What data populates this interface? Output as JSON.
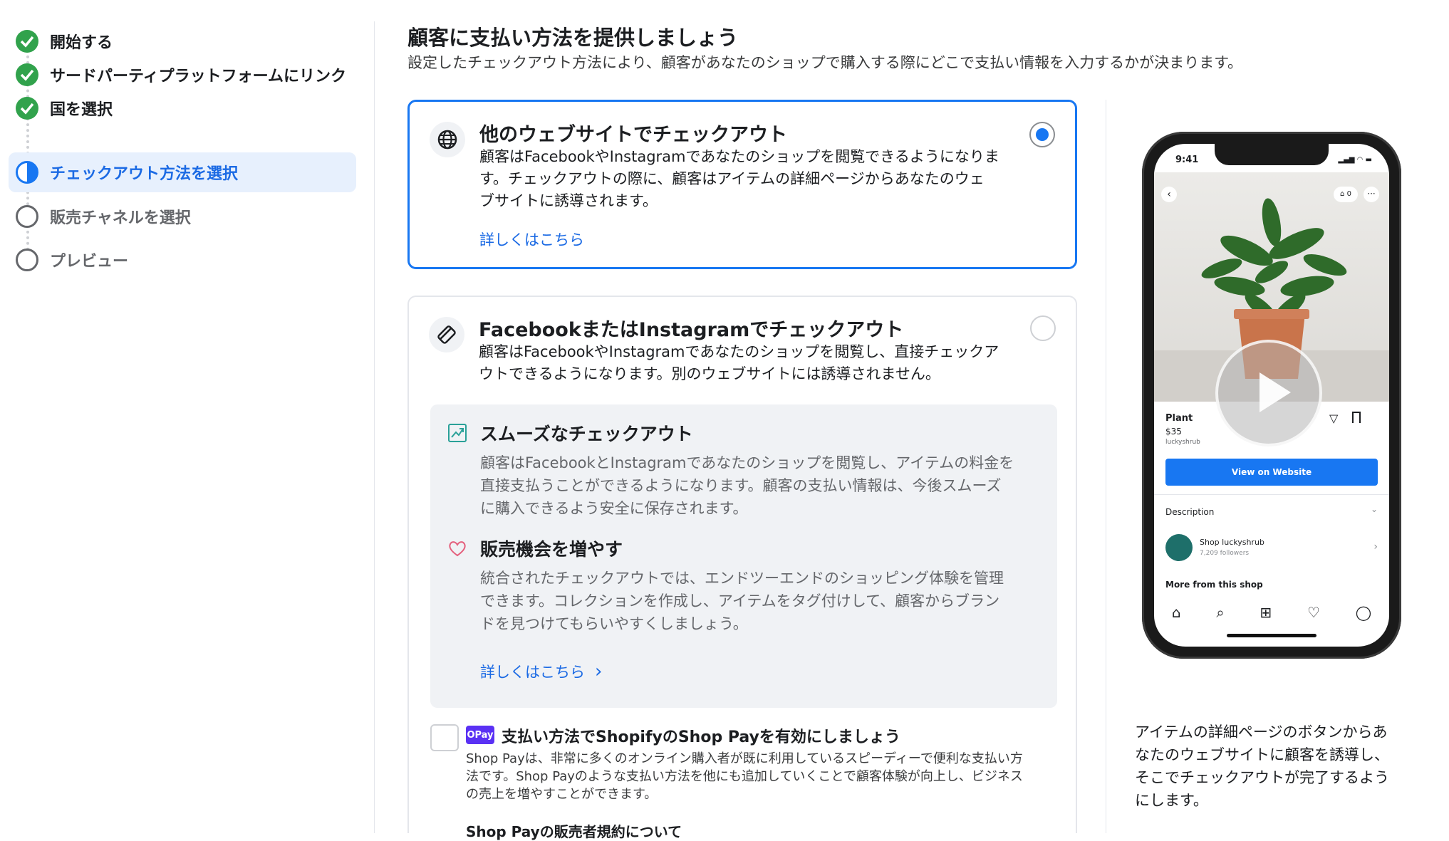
{
  "sidebar": {
    "steps": [
      {
        "label": "開始する",
        "state": "done"
      },
      {
        "label": "サードパーティプラットフォームにリンク",
        "state": "done"
      },
      {
        "label": "国を選択",
        "state": "done"
      },
      {
        "label": "チェックアウト方法を選択",
        "state": "active"
      },
      {
        "label": "販売チャネルを選択",
        "state": "pending"
      },
      {
        "label": "プレビュー",
        "state": "pending"
      }
    ]
  },
  "header": {
    "title": "顧客に支払い方法を提供しましょう",
    "subtitle": "設定したチェックアウト方法により、顧客があなたのショップで購入する際にどこで支払い情報を入力するかが決まります。"
  },
  "option_website": {
    "title": "他のウェブサイトでチェックアウト",
    "desc_lines": [
      "顧客はFacebookやInstagramであなたのショップを閲覧できるようになりま",
      "す。チェックアウトの際に、顧客はアイテムの詳細ページからあなたのウェ",
      "ブサイトに誘導されます。"
    ],
    "link": "詳しくはこちら",
    "selected": true
  },
  "option_meta": {
    "title": "FacebookまたはInstagramでチェックアウト",
    "desc_lines": [
      "顧客はFacebookやInstagramであなたのショップを閲覧し、直接チェックア",
      "ウトできるようになります。別のウェブサイトには誘導されません。"
    ],
    "selected": false,
    "benefits": [
      {
        "icon": "trend-chart-icon",
        "title": "スムーズなチェックアウト",
        "lines": [
          "顧客はFacebookとInstagramであなたのショップを閲覧し、アイテムの料金を",
          "直接支払うことができるようになります。顧客の支払い情報は、今後スムーズ",
          "に購入できるよう安全に保存されます。"
        ]
      },
      {
        "icon": "heart-icon",
        "title": "販売機会を増やす",
        "lines": [
          "統合されたチェックアウトでは、エンドツーエンドのショッピング体験を管理",
          "できます。コレクションを作成し、アイテムをタグ付けして、顧客からブラン",
          "ドを見つけてもらいやすくしましょう。"
        ]
      }
    ],
    "link": "詳しくはこちら",
    "shoppay": {
      "badge": "OPay",
      "title": "支払い方法でShopifyのShop Payを有効にしましょう",
      "desc_lines": [
        "Shop Payは、非常に多くのオンライン購入者が既に利用しているスピーディーで便利な支払い方",
        "法です。Shop Payのような支払い方法を他にも追加していくことで顧客体験が向上し、ビジネス",
        "の売上を増やすことができます。"
      ],
      "terms": "Shop Payの販売者規約について",
      "checked": false
    }
  },
  "preview": {
    "time": "9:41",
    "product_name": "Plant",
    "price": "$35",
    "shop_handle": "luckyshrub",
    "button": "View on Website",
    "description_label": "Description",
    "shop_name": "Shop luckyshrub",
    "followers": "7,209 followers",
    "more_label": "More from this shop",
    "cart_count": "0",
    "caption_lines": [
      "アイテムの詳細ページのボタンからあ",
      "なたのウェブサイトに顧客を誘導し、",
      "そこでチェックアウトが完了するよう",
      "にします。"
    ]
  },
  "colors": {
    "accent": "#1877f2",
    "done": "#31a24c",
    "shoppay": "#5a31f4"
  }
}
